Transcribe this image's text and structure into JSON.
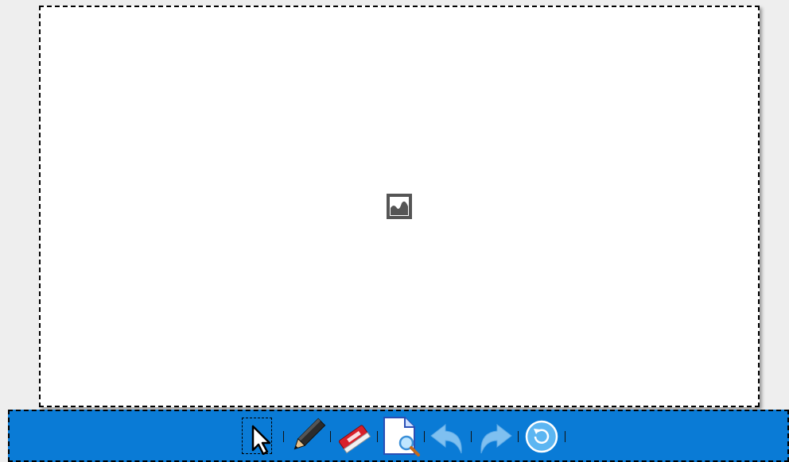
{
  "canvas": {
    "placeholder_icon": "image-placeholder-icon"
  },
  "toolbar": {
    "accent": "#0a7bd6",
    "tools": [
      {
        "name": "select-tool",
        "icon": "arrow-cursor-icon",
        "selected": true
      },
      {
        "name": "pencil-tool",
        "icon": "pencil-icon",
        "selected": false
      },
      {
        "name": "eraser-tool",
        "icon": "eraser-icon",
        "selected": false
      },
      {
        "name": "preview-tool",
        "icon": "magnifier-document-icon",
        "selected": false
      },
      {
        "name": "undo-tool",
        "icon": "undo-arrow-icon",
        "selected": false
      },
      {
        "name": "redo-tool",
        "icon": "redo-arrow-icon",
        "selected": false
      },
      {
        "name": "reset-tool",
        "icon": "reset-circle-icon",
        "selected": false
      }
    ]
  }
}
